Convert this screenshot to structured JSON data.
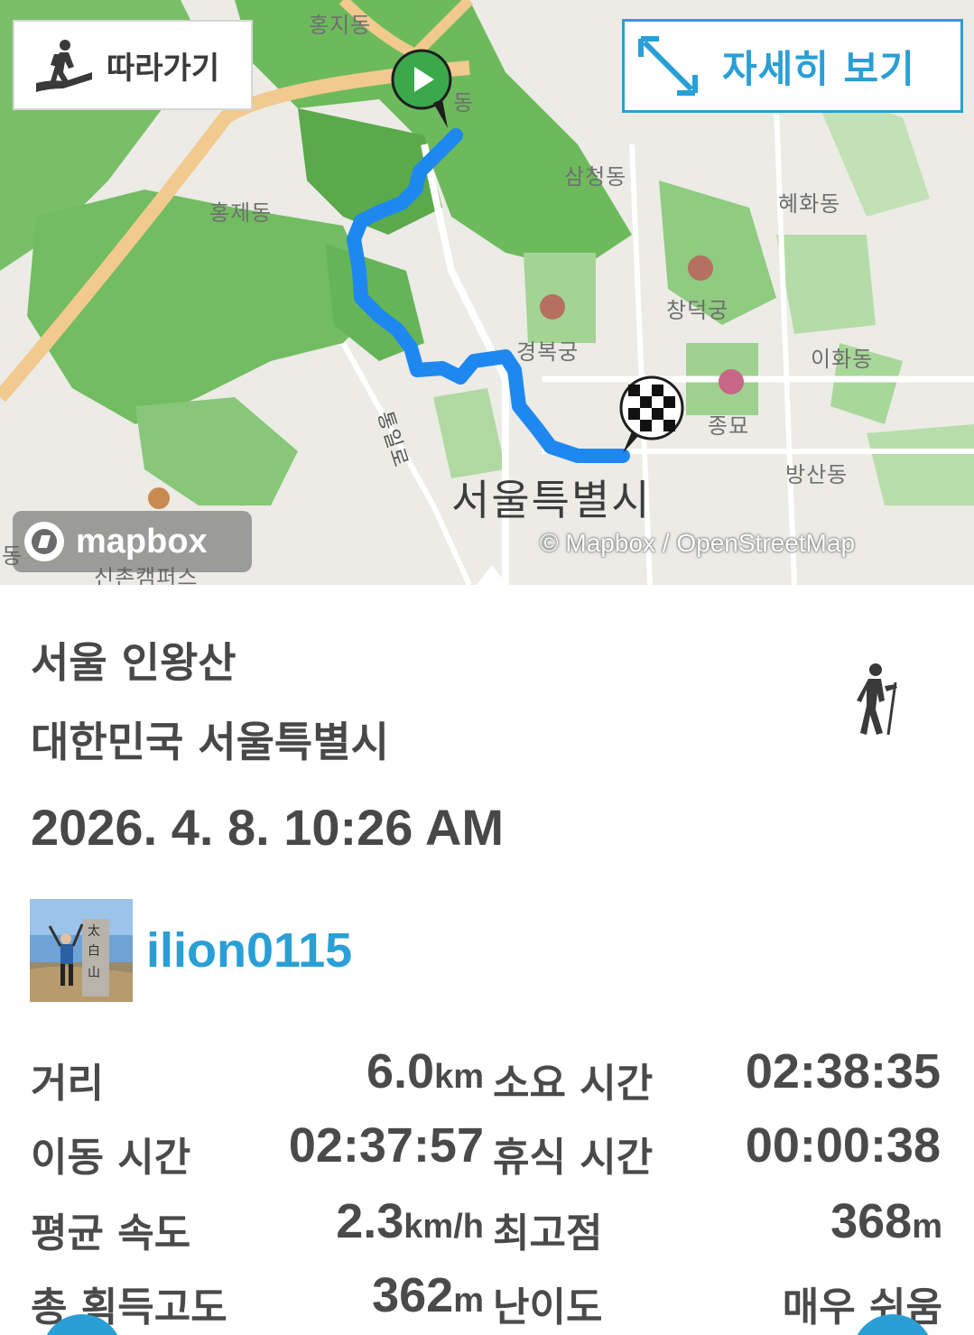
{
  "map": {
    "follow_label": "따라가기",
    "detail_label": "자세히 보기",
    "mapbox_text": "mapbox",
    "attribution": "© Mapbox / OpenStreetMap",
    "labels": {
      "hongjidong": "홍지동",
      "dong_partial": "동",
      "samcheongdong": "삼청동",
      "hyehwadong": "혜화동",
      "hongjedong": "홍제동",
      "changdeokgung": "창덕궁",
      "gyeongbokgung": "경복궁",
      "ihwadong": "이화동",
      "tongillo": "통일로",
      "jongmyo": "종묘",
      "bangsandong": "방산동",
      "seoul": "서울특별시",
      "sinchon": "신촌캠퍼스",
      "jongno_partial": "동",
      "left_partial": "동"
    },
    "colors": {
      "route": "#1e88f0",
      "park": "#8cc97a",
      "forest": "#5fb34f",
      "road": "#f3c98b"
    }
  },
  "track": {
    "title": "서울 인왕산",
    "location": "대한민국 서울특별시",
    "datetime": "2026. 4. 8. 10:26 AM",
    "username": "ilion0115",
    "activity_icon": "hiker-icon"
  },
  "stats": {
    "distance": {
      "label": "거리",
      "value": "6.0",
      "unit": "km"
    },
    "total_time": {
      "label": "소요 시간",
      "value": "02:38:35"
    },
    "moving_time": {
      "label": "이동 시간",
      "value": "02:37:57"
    },
    "rest_time": {
      "label": "휴식 시간",
      "value": "00:00:38"
    },
    "avg_speed": {
      "label": "평균 속도",
      "value": "2.3",
      "unit": "km/h"
    },
    "max_elevation": {
      "label": "최고점",
      "value": "368",
      "unit": "m"
    },
    "total_ascent": {
      "label": "총 획득고도",
      "value": "362",
      "unit": "m"
    },
    "difficulty": {
      "label": "난이도",
      "value": "매우 쉬움"
    }
  }
}
